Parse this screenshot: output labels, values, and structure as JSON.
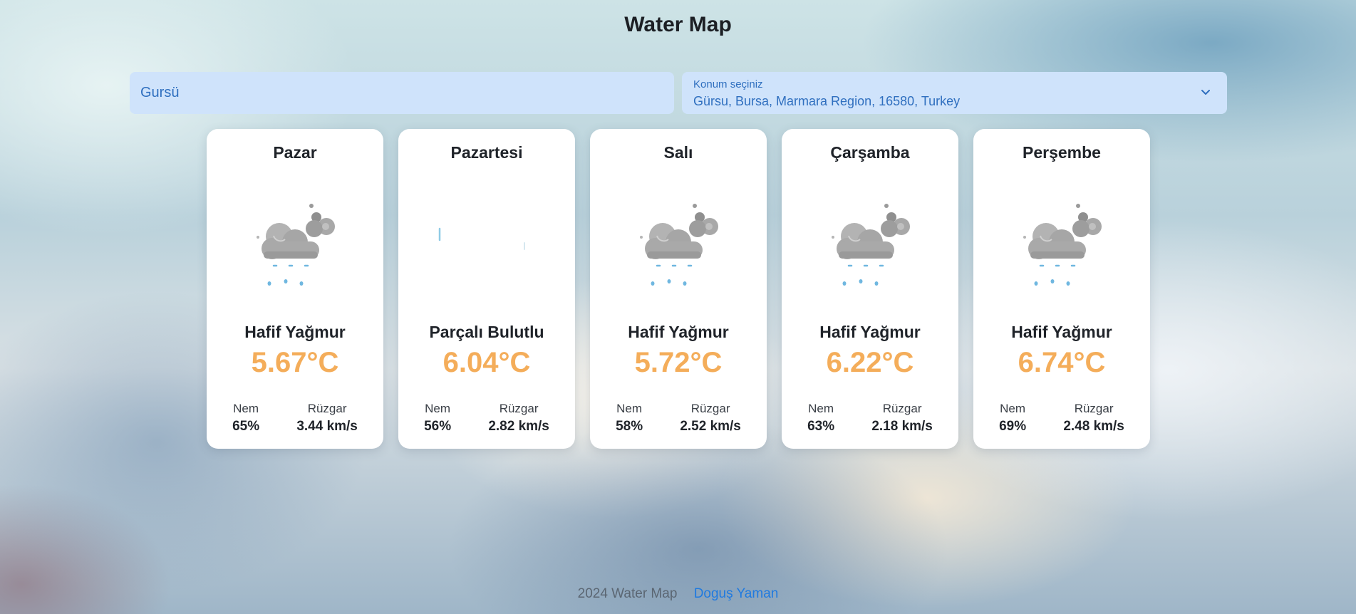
{
  "app": {
    "title": "Water Map"
  },
  "search": {
    "value": "Gursü"
  },
  "location": {
    "label": "Konum seçiniz",
    "value": "Gürsu, Bursa, Marmara Region, 16580, Turkey"
  },
  "forecast": [
    {
      "day": "Pazar",
      "condition": "Hafif Yağmur",
      "temp": "5.67°C",
      "humidity_label": "Nem",
      "humidity": "65%",
      "wind_label": "Rüzgar",
      "wind": "3.44 km/s",
      "icon": "light-rain-icon"
    },
    {
      "day": "Pazartesi",
      "condition": "Parçalı Bulutlu",
      "temp": "6.04°C",
      "humidity_label": "Nem",
      "humidity": "56%",
      "wind_label": "Rüzgar",
      "wind": "2.82 km/s",
      "icon": "partly-cloudy-icon"
    },
    {
      "day": "Salı",
      "condition": "Hafif Yağmur",
      "temp": "5.72°C",
      "humidity_label": "Nem",
      "humidity": "58%",
      "wind_label": "Rüzgar",
      "wind": "2.52 km/s",
      "icon": "light-rain-icon"
    },
    {
      "day": "Çarşamba",
      "condition": "Hafif Yağmur",
      "temp": "6.22°C",
      "humidity_label": "Nem",
      "humidity": "63%",
      "wind_label": "Rüzgar",
      "wind": "2.18 km/s",
      "icon": "light-rain-icon"
    },
    {
      "day": "Perşembe",
      "condition": "Hafif Yağmur",
      "temp": "6.74°C",
      "humidity_label": "Nem",
      "humidity": "69%",
      "wind_label": "Rüzgar",
      "wind": "2.48 km/s",
      "icon": "light-rain-icon"
    }
  ],
  "footer": {
    "copyright": "2024 Water Map",
    "author_link": "Doguş Yaman"
  },
  "colors": {
    "temperature": "#f4ad5a",
    "input_background": "#cfe3fb",
    "link": "#1f7ae0"
  }
}
